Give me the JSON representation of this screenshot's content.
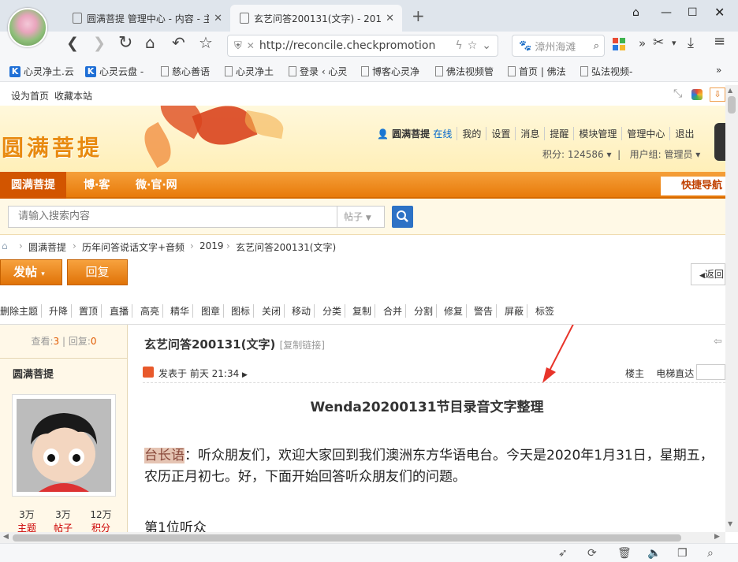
{
  "browser": {
    "tabs": [
      {
        "title": "圆满菩提 管理中心 - 内容 - 主"
      },
      {
        "title": "玄艺问答200131(文字) - 2019"
      }
    ],
    "url": "http://reconcile.checkpromotion",
    "search_text": "漳州海滩",
    "bookmarks": [
      {
        "label": "心灵净土.云"
      },
      {
        "label": "心灵云盘 -"
      },
      {
        "label": "慈心善语"
      },
      {
        "label": "心灵净土"
      },
      {
        "label": "登录 ‹ 心灵"
      },
      {
        "label": "博客心灵净"
      },
      {
        "label": "佛法视频管"
      },
      {
        "label": "首页 | 佛法"
      },
      {
        "label": "弘法视频-"
      }
    ],
    "more_bookmarks": "»"
  },
  "favbar": {
    "set_home": "设为首页",
    "bookmark_site": "收藏本站"
  },
  "header": {
    "logo": "圆满菩提",
    "username": "圆满菩提",
    "online": "在线",
    "user_menu": [
      "我的",
      "设置",
      "消息",
      "提醒",
      "模块管理",
      "管理中心",
      "退出"
    ],
    "points": "积分: 124586",
    "group": "用户组: 管理员"
  },
  "nav": {
    "items": [
      "圆满菩提",
      "博·客",
      "微·官·网"
    ],
    "quick_nav": "快捷导航"
  },
  "search": {
    "placeholder": "请输入搜索内容",
    "type": "帖子"
  },
  "breadcrumbs": [
    "圆满菩提",
    "历年问答说话文字+音频",
    "2019",
    "玄艺问答200131(文字)"
  ],
  "actions": {
    "post": "发帖",
    "reply": "回复",
    "back": "返回"
  },
  "mod_tools": [
    "删除主题",
    "升降",
    "置顶",
    "直播",
    "高亮",
    "精华",
    "图章",
    "图标",
    "关闭",
    "移动",
    "分类",
    "复制",
    "合并",
    "分割",
    "修复",
    "警告",
    "屏蔽",
    "标签"
  ],
  "thread": {
    "views_label": "查看:",
    "views": "3",
    "replies_label": "回复:",
    "replies": "0",
    "title": "玄艺问答200131(文字)",
    "copy_link": "[复制链接]",
    "author": "圆满菩提",
    "posted": "发表于 前天 21:34",
    "floor": "楼主",
    "jump": "电梯直达",
    "user_stats": [
      {
        "value": "3万",
        "label": "主题"
      },
      {
        "value": "3万",
        "label": "帖子"
      },
      {
        "value": "12万",
        "label": "积分"
      }
    ],
    "heading": "Wenda20200131节目录音文字整理",
    "speaker": "台长语",
    "paragraph": "：听众朋友们，欢迎大家回到我们澳洲东方华语电台。今天是2020年1月31日，星期五，农历正月初七。好，下面开始回答听众朋友们的问题。",
    "next": "第1位听众"
  }
}
